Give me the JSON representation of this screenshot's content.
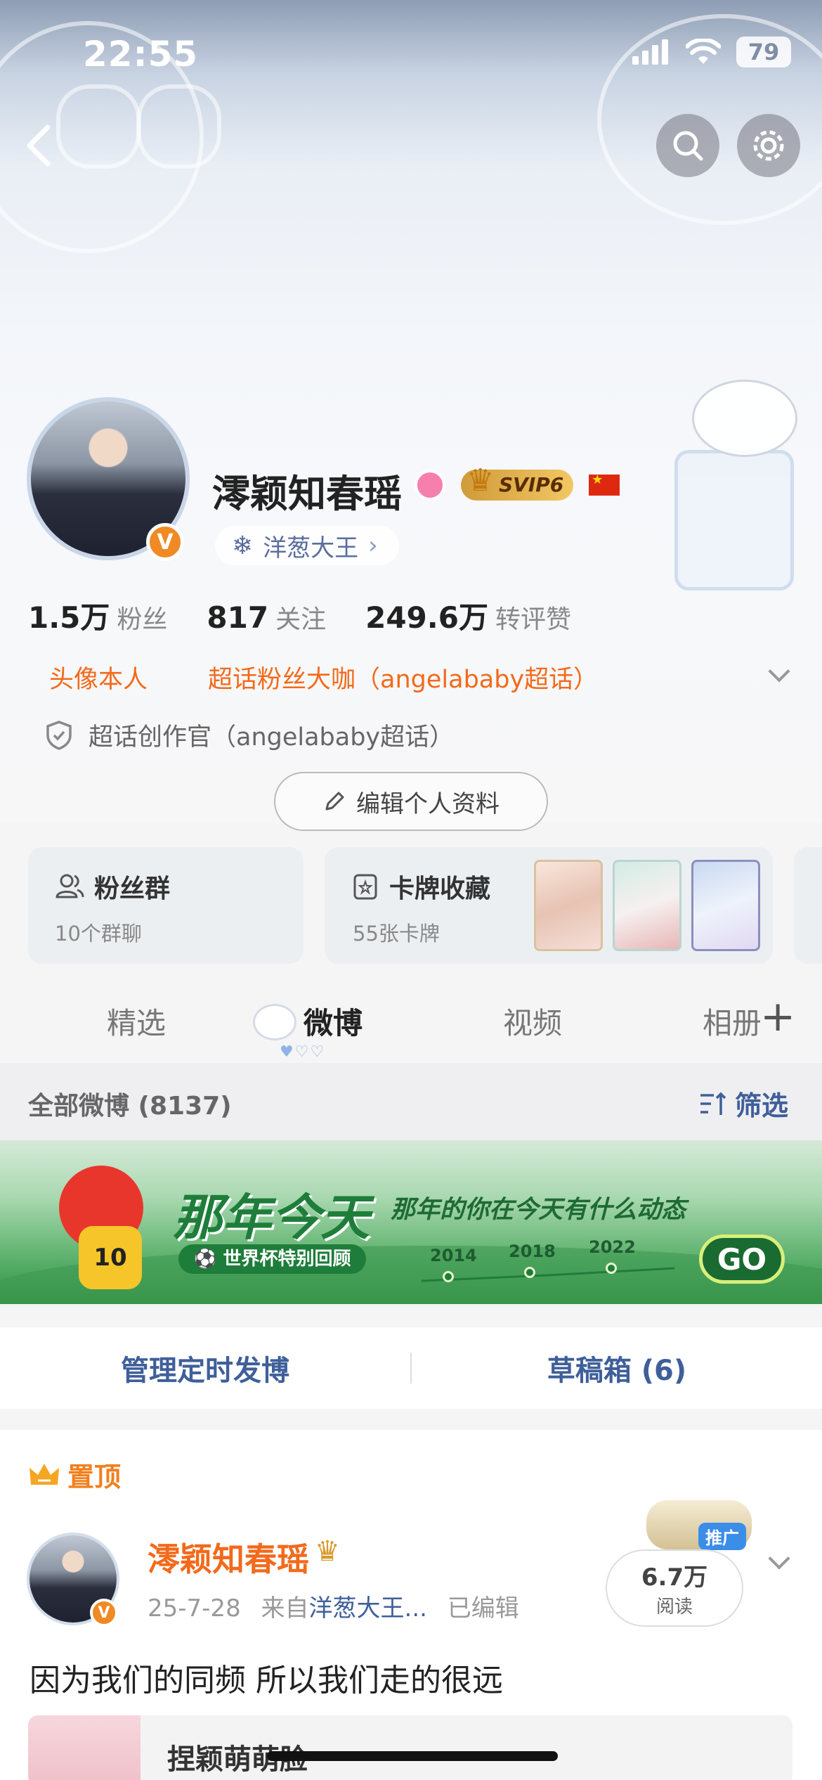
{
  "status_bar": {
    "time": "22:55",
    "battery": "79"
  },
  "profile": {
    "name": "澪颖知春瑶",
    "vip_label": "SVIP6",
    "sub_pill": "洋葱大王",
    "verify_badge": "V",
    "stats": [
      {
        "value": "1.5万",
        "label": "粉丝"
      },
      {
        "value": "817",
        "label": "关注"
      },
      {
        "value": "249.6万",
        "label": "转评赞"
      }
    ],
    "tags": [
      "头像本人",
      "超话粉丝大咖（angelababy超话）"
    ],
    "creator_tag": "超话创作官（angelababy超话）",
    "edit_button": "编辑个人资料"
  },
  "cards": {
    "fans_group": {
      "title": "粉丝群",
      "subtitle": "10个群聊"
    },
    "card_collection": {
      "title": "卡牌收藏",
      "subtitle": "55张卡牌"
    }
  },
  "tabs": [
    "精选",
    "微博",
    "视频",
    "相册"
  ],
  "active_tab_index": 1,
  "feed_header": {
    "title": "全部微博 (8137)",
    "filter": "筛选"
  },
  "ad_banner": {
    "title": "那年今天",
    "subtitle": "那年的你在今天有什么动态",
    "badge": "世界杯特别回顾",
    "years": [
      "2014",
      "2018",
      "2022"
    ],
    "go_label": "GO",
    "mascot_number": "10"
  },
  "manage_bar": {
    "scheduled": "管理定时发博",
    "drafts": "草稿箱 (6)"
  },
  "post": {
    "pinned_label": "置顶",
    "author": "澪颖知春瑶",
    "verify_badge": "V",
    "date": "25-7-28",
    "source_prefix": "来自",
    "source": "洋葱大王...",
    "edited": "已编辑",
    "read_count": "6.7万",
    "read_label": "阅读",
    "promo_label": "推广",
    "text": "因为我们的同频 所以我们走的很远",
    "subcard_title": "捏颖萌萌脸"
  },
  "colors": {
    "accent_orange": "#f26a1b",
    "link_blue": "#3f5f9a",
    "gold": "#e8b442"
  }
}
